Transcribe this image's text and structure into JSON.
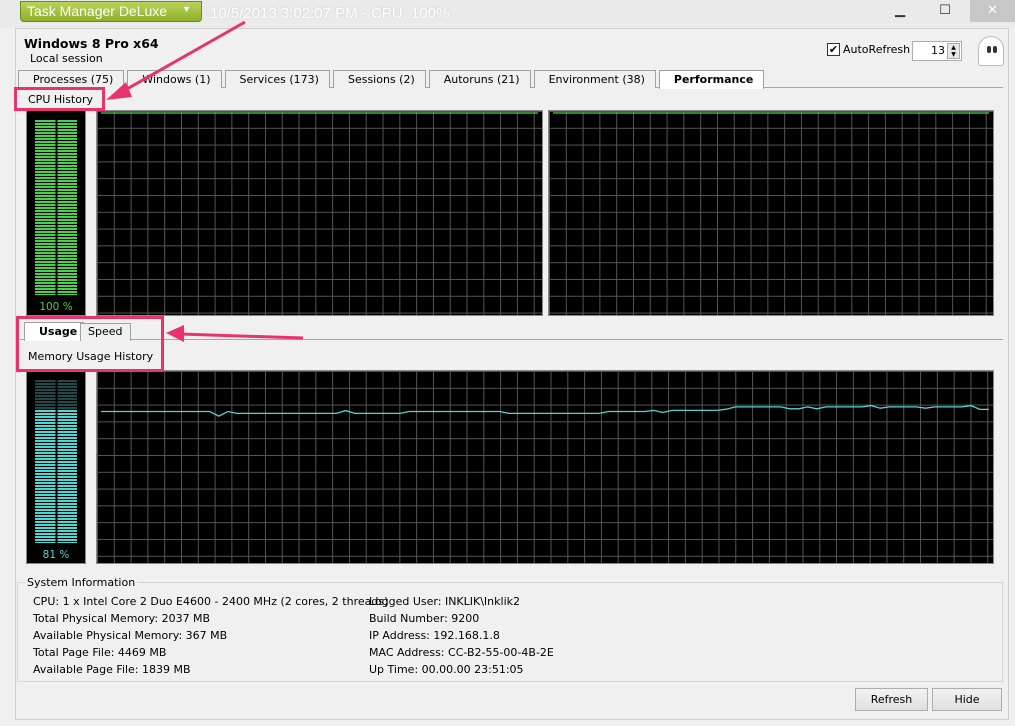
{
  "titlebar": {
    "app_name": "Task Manager DeLuxe",
    "status": "10/5/2013 3:02:07 PM - CPU: 100%",
    "minimize": "▁",
    "maximize": "☐",
    "close": "✕"
  },
  "header": {
    "os_name": "Windows 8 Pro x64",
    "session": "Local session",
    "autorefresh_label": "AutoRefresh",
    "autorefresh_checked": true,
    "refresh_interval": "13"
  },
  "tabs": [
    {
      "label": "Processes (75)"
    },
    {
      "label": "Windows (1)"
    },
    {
      "label": "Services (173)"
    },
    {
      "label": "Sessions (2)"
    },
    {
      "label": "Autoruns (21)"
    },
    {
      "label": "Environment (38)"
    },
    {
      "label": "Performance",
      "active": true
    }
  ],
  "cpu": {
    "title": "CPU History",
    "percent_label": "100 %",
    "percent": 100,
    "color": "#4cd04c",
    "core_series": [
      [
        99,
        99,
        99,
        99,
        99,
        99,
        99,
        99,
        99,
        99,
        99,
        99
      ],
      [
        99,
        99,
        99,
        99,
        99,
        99,
        99,
        99,
        99,
        99,
        99,
        99
      ]
    ]
  },
  "memory": {
    "subtabs": [
      {
        "label": "Usage",
        "active": true
      },
      {
        "label": "Speed"
      }
    ],
    "title": "Memory Usage History",
    "percent_label": "81 %",
    "percent": 81,
    "color": "#4fd6d0",
    "series": [
      78.9,
      78.9,
      78.9,
      78.9,
      78.9,
      78.9,
      78.9,
      78.9,
      78.9,
      78.9,
      78.9,
      78.9,
      78.9,
      76.5,
      78.9,
      77.9,
      77.9,
      77.9,
      77.9,
      77.9,
      77.9,
      77.9,
      77.9,
      77.9,
      77.9,
      77.9,
      77.9,
      79.4,
      77.9,
      77.9,
      77.9,
      77.9,
      77.9,
      77.9,
      78.9,
      78.9,
      78.9,
      78.9,
      78.9,
      78.9,
      78.9,
      78.9,
      78.9,
      78.9,
      78.9,
      77.9,
      77.9,
      77.9,
      77.9,
      77.9,
      77.9,
      77.9,
      77.9,
      77.9,
      77.9,
      77.9,
      78.9,
      78.9,
      78.9,
      78.9,
      78.9,
      79.5,
      78.4,
      79.5,
      79.5,
      79.5,
      79.5,
      79.5,
      79.5,
      80.1,
      81.3,
      81.3,
      81.3,
      81.3,
      81.3,
      81.3,
      80.3,
      80.3,
      81.3,
      80.3,
      81.3,
      81.3,
      81.3,
      81.3,
      81.3,
      82.0,
      80.6,
      81.3,
      81.3,
      81.3,
      81.3,
      80.6,
      81.3,
      81.3,
      81.3,
      81.3,
      82.0,
      80.0,
      80.0
    ]
  },
  "system_info": {
    "title": "System Information",
    "left": [
      "CPU: 1 x Intel Core 2 Duo E4600 - 2400 MHz (2 cores, 2 threads)",
      "Total Physical Memory: 2037 MB",
      "Available Physical Memory: 367 MB",
      "Total Page File: 4469 MB",
      "Available Page File: 1839 MB"
    ],
    "right": [
      "Logged User: INKLIK\\Inklik2",
      "Build Number: 9200",
      "IP Address: 192.168.1.8",
      "MAC Address: CC-B2-55-00-4B-2E",
      "Up Time: 00.00.00 23:51:05"
    ]
  },
  "buttons": {
    "refresh": "Refresh",
    "hide": "Hide"
  },
  "annotation_color": "#e8336d"
}
